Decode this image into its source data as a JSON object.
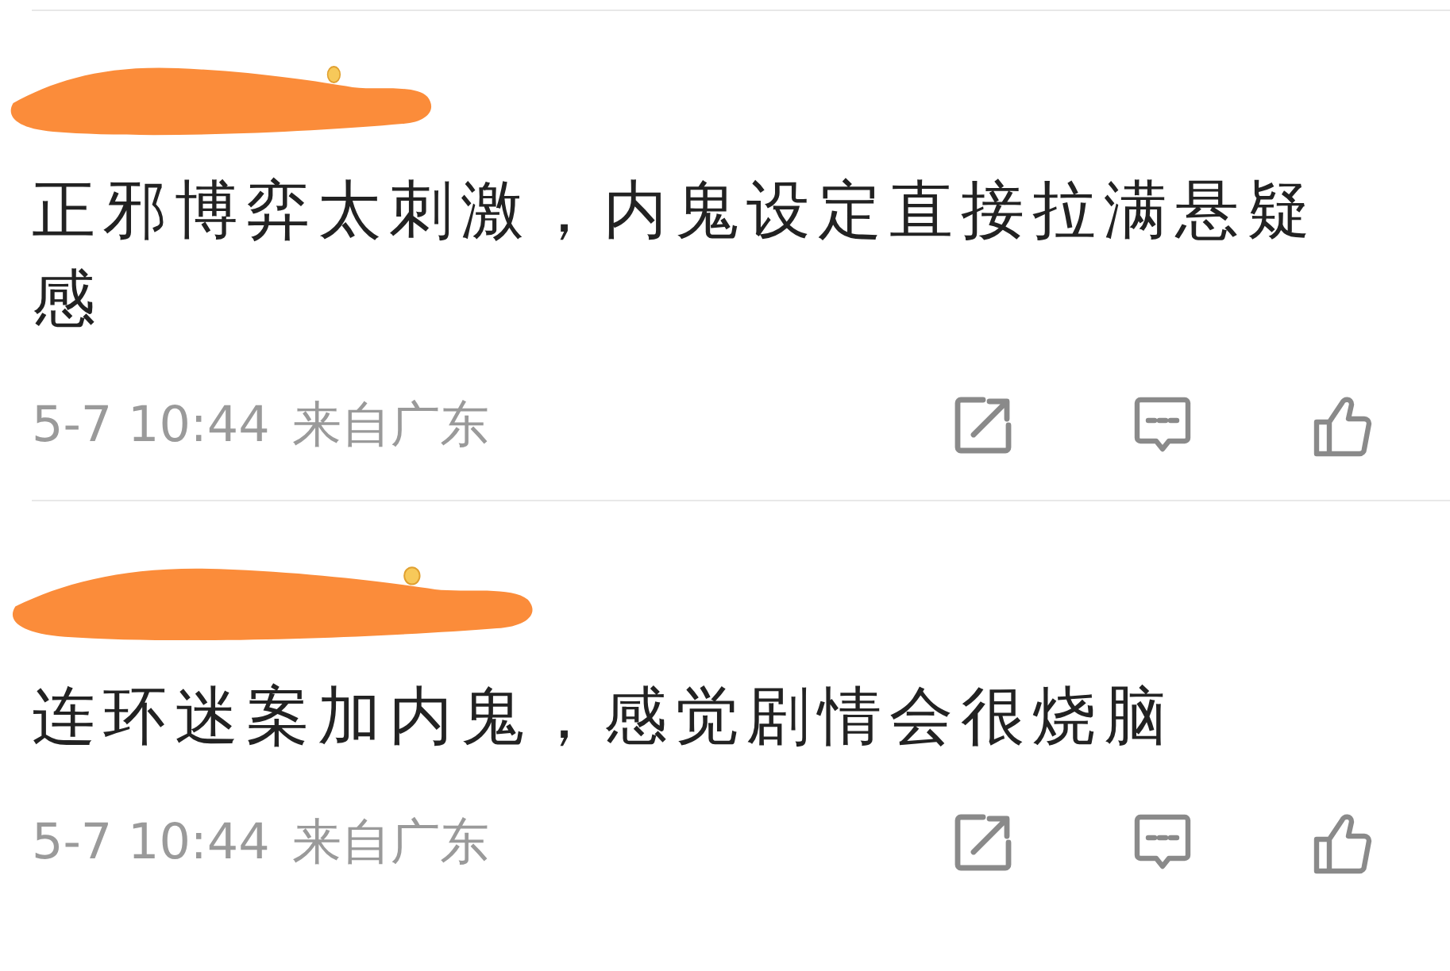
{
  "comments": [
    {
      "text": "正邪博弈太刺激，内鬼设定直接拉满悬疑感",
      "time": "5-7 10:44",
      "location": "来自广东"
    },
    {
      "text": "连环迷案加内鬼，感觉剧情会很烧脑",
      "time": "5-7 10:44",
      "location": "来自广东"
    }
  ]
}
